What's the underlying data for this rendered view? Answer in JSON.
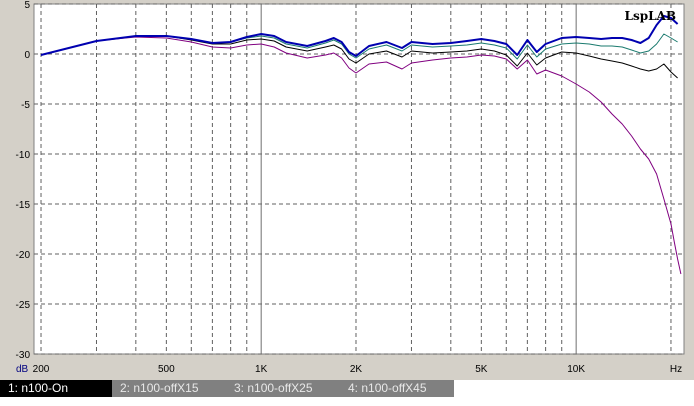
{
  "chart_data": {
    "type": "line",
    "watermark": "LspLAB",
    "ylabel": "dB",
    "xunit": "Hz",
    "xscale": "log",
    "xlim": [
      190,
      22000
    ],
    "ylim": [
      -30,
      5
    ],
    "y_ticks": [
      5,
      0,
      -5,
      -10,
      -15,
      -20,
      -25,
      -30
    ],
    "x_tick_labels": [
      {
        "value": 200,
        "label": "200"
      },
      {
        "value": 500,
        "label": "500"
      },
      {
        "value": 1000,
        "label": "1K"
      },
      {
        "value": 2000,
        "label": "2K"
      },
      {
        "value": 5000,
        "label": "5K"
      },
      {
        "value": 10000,
        "label": "10K"
      }
    ],
    "series": [
      {
        "name": "1: n100-On",
        "color": "#0000b0",
        "width": 2,
        "x": [
          200,
          300,
          400,
          500,
          600,
          700,
          800,
          900,
          1000,
          1100,
          1200,
          1400,
          1600,
          1700,
          1800,
          1900,
          2000,
          2200,
          2500,
          2800,
          3000,
          3500,
          4000,
          4500,
          5000,
          5500,
          6000,
          6500,
          7000,
          7500,
          8000,
          9000,
          10000,
          11000,
          12000,
          13000,
          14000,
          15000,
          16000,
          17000,
          18000,
          19000,
          20000,
          21000
        ],
        "y": [
          -0.1,
          1.3,
          1.8,
          1.8,
          1.5,
          1.1,
          1.2,
          1.7,
          2.0,
          1.8,
          1.2,
          0.8,
          1.3,
          1.6,
          1.2,
          0.2,
          -0.2,
          0.8,
          1.2,
          0.6,
          1.2,
          1.0,
          1.1,
          1.3,
          1.5,
          1.3,
          1.0,
          -0.1,
          1.4,
          0.2,
          1.0,
          1.6,
          1.7,
          1.6,
          1.5,
          1.6,
          1.6,
          1.4,
          1.1,
          1.6,
          2.9,
          3.8,
          3.6,
          3.0
        ]
      },
      {
        "name": "2: n100-offX15",
        "color": "#1a7a6e",
        "width": 1,
        "x": [
          200,
          300,
          400,
          500,
          600,
          700,
          800,
          900,
          1000,
          1100,
          1200,
          1400,
          1600,
          1700,
          1800,
          1900,
          2000,
          2200,
          2500,
          2800,
          3000,
          3500,
          4000,
          4500,
          5000,
          5500,
          6000,
          6500,
          7000,
          7500,
          8000,
          9000,
          10000,
          11000,
          12000,
          13000,
          14000,
          15000,
          16000,
          17000,
          18000,
          19000,
          20000,
          21000
        ],
        "y": [
          -0.1,
          1.3,
          1.8,
          1.8,
          1.5,
          1.1,
          1.2,
          1.6,
          1.8,
          1.6,
          1.0,
          0.6,
          1.1,
          1.4,
          1.0,
          0.0,
          -0.4,
          0.5,
          0.9,
          0.3,
          0.9,
          0.7,
          0.8,
          0.9,
          1.1,
          0.9,
          0.6,
          -0.5,
          0.9,
          -0.3,
          0.5,
          1.0,
          1.1,
          1.0,
          0.8,
          0.8,
          0.7,
          0.4,
          0.1,
          0.3,
          1.0,
          2.0,
          1.6,
          1.2
        ]
      },
      {
        "name": "3: n100-offX25",
        "color": "#000000",
        "width": 1,
        "x": [
          200,
          300,
          400,
          500,
          600,
          700,
          800,
          900,
          1000,
          1100,
          1200,
          1400,
          1600,
          1700,
          1800,
          1900,
          2000,
          2200,
          2500,
          2800,
          3000,
          3500,
          4000,
          4500,
          5000,
          5500,
          6000,
          6500,
          7000,
          7500,
          8000,
          9000,
          10000,
          11000,
          12000,
          13000,
          14000,
          15000,
          16000,
          17000,
          18000,
          19000,
          20000,
          21000
        ],
        "y": [
          -0.1,
          1.3,
          1.8,
          1.8,
          1.4,
          1.0,
          1.0,
          1.4,
          1.5,
          1.3,
          0.7,
          0.3,
          0.7,
          0.9,
          0.5,
          -0.5,
          -0.9,
          0.0,
          0.3,
          -0.3,
          0.3,
          0.1,
          0.2,
          0.3,
          0.5,
          0.3,
          -0.1,
          -1.2,
          0.1,
          -1.1,
          -0.4,
          0.2,
          0.1,
          -0.2,
          -0.5,
          -0.7,
          -0.9,
          -1.2,
          -1.5,
          -1.7,
          -1.5,
          -1.0,
          -1.8,
          -2.4
        ]
      },
      {
        "name": "4: n100-offX45",
        "color": "#800080",
        "width": 1,
        "x": [
          200,
          300,
          400,
          500,
          600,
          700,
          800,
          900,
          1000,
          1100,
          1200,
          1400,
          1600,
          1700,
          1800,
          1900,
          2000,
          2200,
          2500,
          2800,
          3000,
          3500,
          4000,
          4500,
          5000,
          5500,
          6000,
          6500,
          7000,
          7500,
          8000,
          9000,
          10000,
          11000,
          12000,
          13000,
          14000,
          15000,
          16000,
          17000,
          18000,
          19000,
          20000,
          20500,
          21000,
          21500
        ],
        "y": [
          -0.1,
          1.3,
          1.7,
          1.6,
          1.2,
          0.7,
          0.6,
          0.9,
          1.0,
          0.7,
          0.1,
          -0.4,
          -0.1,
          0.1,
          -0.4,
          -1.4,
          -1.9,
          -1.0,
          -0.8,
          -1.5,
          -0.9,
          -0.6,
          -0.4,
          -0.3,
          -0.1,
          -0.2,
          -0.5,
          -1.5,
          -0.6,
          -2.0,
          -1.6,
          -2.2,
          -3.0,
          -3.8,
          -4.8,
          -6.0,
          -7.0,
          -8.2,
          -9.5,
          -10.5,
          -12.0,
          -14.5,
          -17.0,
          -18.8,
          -20.5,
          -22.0
        ]
      }
    ]
  },
  "legend": {
    "items": [
      {
        "label": "1: n100-On",
        "active": true
      },
      {
        "label": "2: n100-offX15",
        "active": false
      },
      {
        "label": "3: n100-offX25",
        "active": false
      },
      {
        "label": "4: n100-offX45",
        "active": false
      }
    ]
  }
}
